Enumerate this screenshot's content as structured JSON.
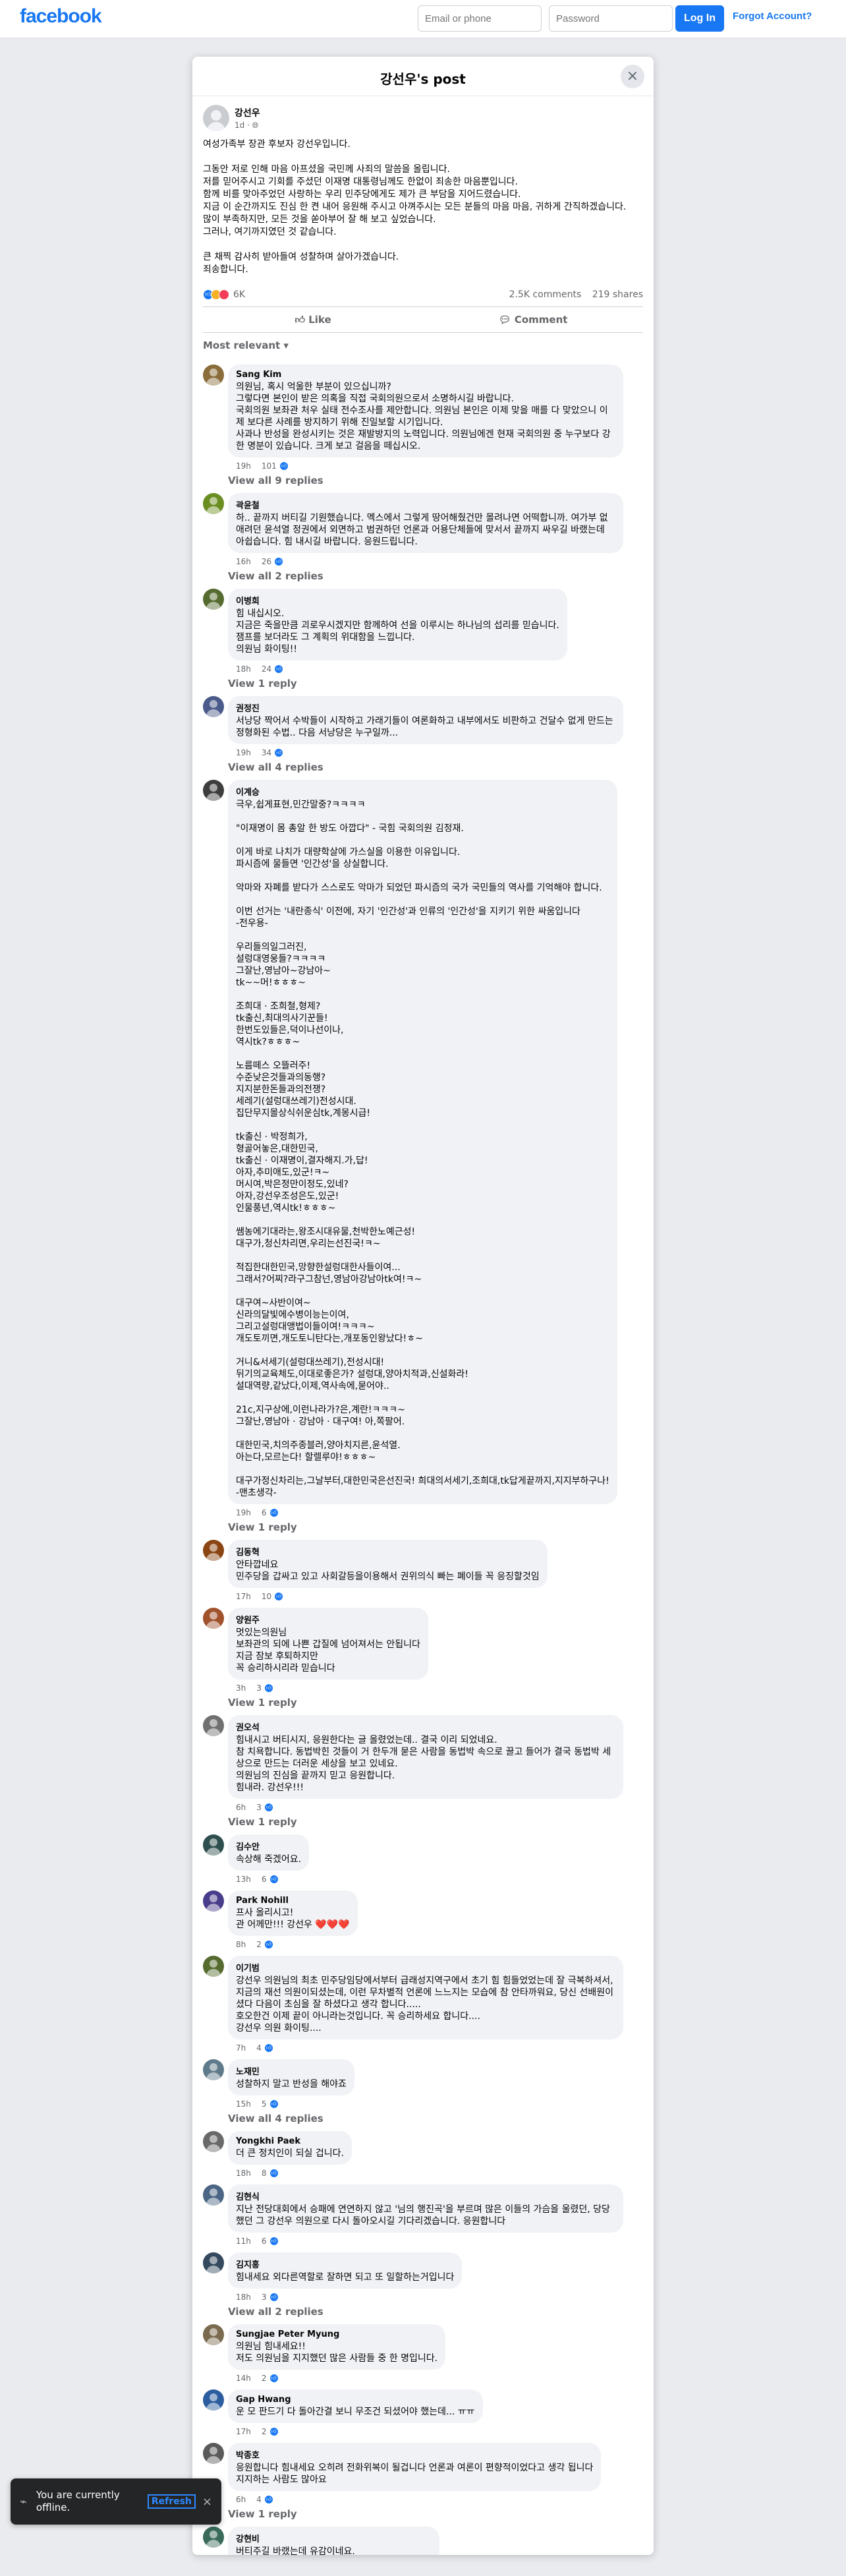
{
  "topbar": {
    "logo": "facebook",
    "email_placeholder": "Email or phone",
    "password_placeholder": "Password",
    "login_label": "Log In",
    "forgot_label": "Forgot Account?"
  },
  "dialog": {
    "title": "강선우's post",
    "close_icon": "×"
  },
  "post": {
    "author": "강선우",
    "time": "1d · ",
    "body": "여성가족부 장관 후보자 강선우입니다.\n\n그동안 저로 인해 마음 아프셨을 국민께 사죄의 말씀을 올립니다.\n저를 믿어주시고 기회를 주셨던 이재명 대통령님께도 한없이 죄송한 마음뿐입니다.\n함께 비를 맞아주었던 사랑하는 우리 민주당에게도 제가 큰 부담을 지어드렸습니다.\n지금 이 순간까지도 진심 한 켠 내어 응원해 주시고 아껴주시는 모든 분들의 마음 마음, 귀하게 간직하겠습니다.\n많이 부족하지만, 모든 것을 쏟아부어 잘 해 보고 싶었습니다.\n그러나, 여기까지였던 것 같습니다.\n\n큰 채찍 감사히 받아들여 성찰하며 살아가겠습니다.\n죄송합니다.",
    "reaction_count": "6K",
    "comments_count": "2.5K comments",
    "shares_count": "219 shares",
    "like_label": "Like",
    "comment_label": "Comment",
    "sort_label": "Most relevant ▾"
  },
  "comments": [
    {
      "name": "Sang Kim",
      "color": "#8a6d3b",
      "text": "의원님, 혹시 억울한 부분이 있으십니까?\n그렇다면 본인이 받은 의혹을 직접 국회의원으로서 소명하시길 바랍니다.\n국회의원 보좌관 처우 실태 전수조사를 제안합니다. 의원님 본인은 이제 맞을 매를 다 맞았으니 이제 보다른 사례를 방지하기 위해 진일보할 시기입니다.\n사과나 반성을 완성시키는 것은 재발방지의 노력입니다. 의원님에겐 현재 국회의원 중 누구보다 강한 명분이 있습니다. 크게 보고 걸음을 떼십시오.",
      "time": "19h",
      "likes": "101",
      "replies": "View all 9 replies"
    },
    {
      "name": "곽윤철",
      "color": "#6b8e23",
      "text": "하.. 끝까지 버티길 기원했습니다. 멕스에서 그렇게 땅어해줬건만 몰려나면 어떡합니까. 여가부 없애려던 윤석열 정권에서 외면하고 범권하던 언론과 어용단체들에 맞서서 끝까지 싸우길 바랬는데 아쉽습니다. 힘 내시길 바랍니다. 응원드립니다.",
      "time": "16h",
      "likes": "26",
      "replies": "View all 2 replies"
    },
    {
      "name": "이병희",
      "color": "#556b2f",
      "text": "힘 내십시오.\n지금은 죽을만큼 괴로우시겠지만 함께하여 선을 이루시는 하나님의 섭리를 믿습니다.\n잼프를 보더라도 그 계획의 위대함을 느낍니다.\n의원님 화이팅!!",
      "time": "18h",
      "likes": "24",
      "replies": "View 1 reply"
    },
    {
      "name": "권정진",
      "color": "#4a5a8a",
      "text": "서낭당 짝어서 수박들이 시작하고 가래기들이 여론화하고 내부에서도 비판하고 건달수 없게 만드는 정형화된 수법.. 다음 서낭당은 누구일까...",
      "time": "19h",
      "likes": "34",
      "replies": "View all 4 replies"
    },
    {
      "name": "이계승",
      "color": "#3d3d3d",
      "text": "극우,쉽게표현,민간말중?ㅋㅋㅋㅋ\n\n\"이재명이 몸 총알 한 방도 아깝다\" - 국힘 국회의원 김정재.\n\n이게 바로 나치가 대량학살에 가스실을 이용한 이유입니다.\n파시즘에 물들면 '인간성'을 상실합니다.\n\n악마와 자폐를 받다가 스스로도 악마가 되었던 파시즘의 국가 국민들의 역사를 기억해야 합니다.\n\n이번 선거는 '내란종식' 이전에, 자기 '인간성'과 인류의 '인간성'을 지키기 위한 싸움입니다\n-전우용-\n\n우리들의일그러진,\n설렁대영웅들?ㅋㅋㅋㅋ\n그잘난,영남아~강남아~\ntk~~머!ㅎㅎㅎ~\n\n조희대 · 조희철,형제?\ntk출신,최대의사기꾼들!\n한번도있들은,덕이나선이나,\n역시tk?ㅎㅎㅎ~\n\n노름떼스 오뜰러주!\n수준낮은것들과의동행?\n지지분한돈들과의전쟁?\n세레기(설렁대쓰레기)전성시대.\n집단무지몰상식쉬운심tk,계몽시급!\n\ntk출신 · 박정희가,\n형골어놓은,대한민국,\ntk출신 · 이재명이,결자해지.가,답!\n아자,추미애도,있군!ㅋ~\n머시여,박은정만이정도,있네?\n아자,강선우조성은도,있군!\n인물풍년,역시tk!ㅎㅎㅎ~\n\n쌤농에기대라는,왕조시대유물,천박한노예근성!\n대구가,청신차리면,우리는선진국!ㅋ~\n\n적집한대한민국,망향한설렁대한사들이여...\n그래서?어찌?라구그참넌,영남아강남아tk여!ㅋ~\n\n대구여~사반이여~\n신라의달빛에수병이능는이여,\n그리고설렁대앵법이들이여!ㅋㅋㅋ~\n개도토끼면,개도토니탄다는,개포동인왕났다!ㅎ~\n\n거니&서세기(설렁대쓰레기),전성시대!\n뒤기의교육체도,이대로좋은가? 설렁대,양아치적과,신설화라!\n설대역량,같났다,이제,역사속에,묻어야..\n\n21c,지구상에,이런나라가?은,계란!ㅋㅋㅋ~\n그잘난,영남아 · 강남아 · 대구여! 아,쪽팔어.\n\n대한민국,치의주종블러,양아치지른,윤석열.\n아는다,모르는다! 할렐루야!ㅎㅎㅎ~\n\n대구가정신차리는,그날부터,대한민국은선진국! 희대의서세기,조희대,tk답게끝까지,지지부하구나!\n-맨초생각-",
      "time": "19h",
      "likes": "6",
      "replies": "View 1 reply"
    },
    {
      "name": "김동혁",
      "color": "#8b4513",
      "text": "안타깝네요\n민주당을 갑싸고 있고 사회갈등을이용해서 권위의식 빠는 폐이들 꼭 응징할것임",
      "time": "17h",
      "likes": "10",
      "replies": ""
    },
    {
      "name": "양원주",
      "color": "#a0522d",
      "text": "멋있는의원님\n보좌관의 되에 나쁜 갑질에 넘어져서는 안됩니다\n지금 잠보 후퇴하지만\n꼭 승리하시리라 믿습니다",
      "time": "3h",
      "likes": "3",
      "replies": "View 1 reply"
    },
    {
      "name": "권오석",
      "color": "#707070",
      "text": "힘내시고 버티시지, 응원한다는 글 올렸었는데.. 결국 이리 되었네요.\n참 치욕합니다. 동법박힌 것들이 거 한두개 묻은 사람을 동법박 속으로 끌고 들어가 결국 동법박 세상으로 만드는 더러운 세상을 보고 있네요.\n의원님의 진심을 끝까지 믿고 응원합니다.\n힘내라. 강선우!!!",
      "time": "6h",
      "likes": "3",
      "replies": "View 1 reply"
    },
    {
      "name": "김수안",
      "color": "#2f4f4f",
      "text": "속상해 죽겠어요.",
      "time": "13h",
      "likes": "6",
      "replies": ""
    },
    {
      "name": "Park Nohill",
      "color": "#483d8b",
      "text": "프사 올리시고!\n관 어께만!!! 강선우 ❤️❤️❤️",
      "time": "8h",
      "likes": "2",
      "replies": ""
    },
    {
      "name": "이기범",
      "color": "#556b2f",
      "text": "강선우 의원님의 최초 민주당임당에서부터 급래성지역구에서 초기 힘 힘들었었는데 잘 극복하셔서, 지금의 재선 의원이되셨는데, 이런 무차별적 언론에 느느지는 모습에 참 안타까워요, 당신 선배원이셨다 다음이 초심을 잘 하셨다고 생각 합니다.....\n호오한건 이제 끝이 아니라는것입니다. 꼭 승리하세요 합니다....\n강선우 의원 화이팅....",
      "time": "7h",
      "likes": "4",
      "replies": ""
    },
    {
      "name": "노재민",
      "color": "#5f7a8a",
      "text": "성찰하지 말고 반성을 해야죠",
      "time": "15h",
      "likes": "5",
      "replies": "View all 4 replies"
    },
    {
      "name": "Yongkhi Paek",
      "color": "#696969",
      "text": "더 큰 정치인이 되실 겁니다.",
      "time": "18h",
      "likes": "8",
      "replies": ""
    },
    {
      "name": "김현식",
      "color": "#4b6584",
      "text": "지난 전당대회에서 승패에 연연하지 않고 '님의 행진곡'을 부르며 많은 이들의 가슴을 울렸던, 당당했던 그 강선우 의원으로 다시 돌아오시길 기다리겠습니다. 응원합니다",
      "time": "11h",
      "likes": "6",
      "replies": ""
    },
    {
      "name": "김지홍",
      "color": "#34495e",
      "text": "힘내세요 외다른역할로 잘하면 되고 또 일할하는거입니다",
      "time": "18h",
      "likes": "3",
      "replies": "View all 2 replies"
    },
    {
      "name": "Sungjae Peter Myung",
      "color": "#7a6a4f",
      "text": "의원님 힘내세요!!\n저도 의원님을 지지했던 많은 사람들 중 한 명입니다.",
      "time": "14h",
      "likes": "2",
      "replies": ""
    },
    {
      "name": "Gap Hwang",
      "color": "#2c5d9e",
      "text": "운 모 판드기 다 돌아간결 보니 무조건 되셨어야 했는데... ㅠㅠ",
      "time": "17h",
      "likes": "2",
      "replies": ""
    },
    {
      "name": "박종호",
      "color": "#5a5a5a",
      "text": "응원합니다 힘내세요 오히려 전화위복이 될겁니다 언론과 여론이 편향적이었다고 생각 됩니다\n지지하는 사람도 많아요",
      "time": "6h",
      "likes": "4",
      "replies": "View 1 reply"
    },
    {
      "name": "강현비",
      "color": "#3a6b5a",
      "text": "버티주길 바랬는데 유감이네요.\n하지만 더 좋은 역할 의 강신우님을 기다리겠습니다",
      "time": "",
      "likes": "",
      "replies": ""
    }
  ],
  "toast": {
    "text": "You are currently offline.",
    "refresh_label": "Refresh",
    "close_icon": "×"
  }
}
